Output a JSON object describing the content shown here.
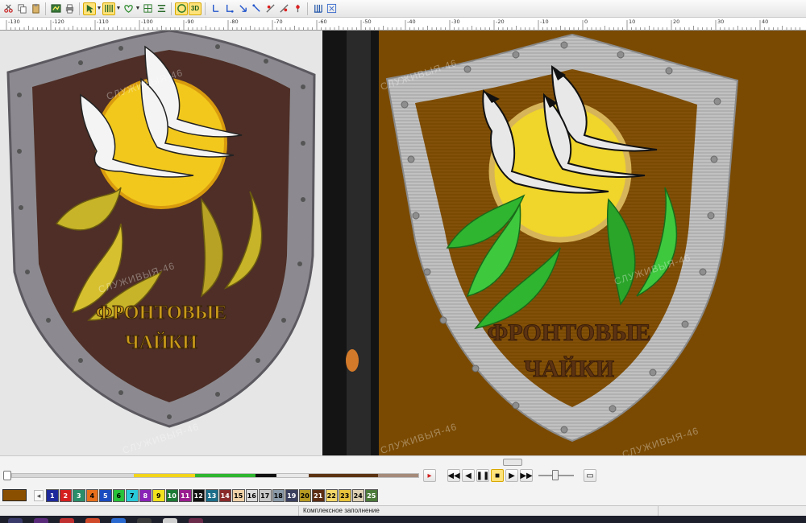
{
  "toolbar": {
    "icons": [
      "cut-icon",
      "copy-icon",
      "paste-icon",
      "stitch-view-icon",
      "print-icon",
      "select-icon",
      "fill-icon",
      "heart-icon",
      "grid-icon",
      "align-icon",
      "realistic-icon",
      "3d-icon",
      "arrow-icon",
      "arrow-icon",
      "arrow-icon",
      "arrow-icon",
      "needle-icon",
      "needle-icon",
      "needle-icon",
      "column-icon",
      "ruler-icon"
    ],
    "view_3d_label": "3D"
  },
  "ruler": {
    "ticks": [
      "-130",
      "-120",
      "-110",
      "-100",
      "-90",
      "-80",
      "-70",
      "-60",
      "-50",
      "-40",
      "-30",
      "-20",
      "-10",
      "0",
      "10",
      "20",
      "30",
      "40"
    ]
  },
  "artwork": {
    "title_line1": "ФРОНТОВЫЕ",
    "title_line2": "ЧАЙКИ",
    "watermark": "СЛУЖИВЫЯ-46",
    "background_color": "#7a4a02",
    "shield_border_color": "#b5b5b5"
  },
  "player": {
    "color_track": [
      {
        "color": "#d7d7d7",
        "share": 30
      },
      {
        "color": "#f2d51a",
        "share": 15
      },
      {
        "color": "#2fb52f",
        "share": 15
      },
      {
        "color": "#111111",
        "share": 5
      },
      {
        "color": "#e8e8e8",
        "share": 8
      },
      {
        "color": "#5c3312",
        "share": 17
      },
      {
        "color": "#a58a7a",
        "share": 10
      }
    ]
  },
  "palette": {
    "current_color": "#8a5000",
    "swatches": [
      {
        "n": "1",
        "c": "#1e2a9b",
        "t": "#ffffff"
      },
      {
        "n": "2",
        "c": "#d51f1f",
        "t": "#ffffff"
      },
      {
        "n": "3",
        "c": "#2a8e6a",
        "t": "#ffffff"
      },
      {
        "n": "4",
        "c": "#e86f1b",
        "t": "#000000"
      },
      {
        "n": "5",
        "c": "#1a4bbf",
        "t": "#ffffff"
      },
      {
        "n": "6",
        "c": "#27c23a",
        "t": "#000000"
      },
      {
        "n": "7",
        "c": "#29c9d9",
        "t": "#000000"
      },
      {
        "n": "8",
        "c": "#8a22b8",
        "t": "#ffffff"
      },
      {
        "n": "9",
        "c": "#f2e11d",
        "t": "#000000"
      },
      {
        "n": "10",
        "c": "#1b7a33",
        "t": "#ffffff"
      },
      {
        "n": "11",
        "c": "#9a1d8f",
        "t": "#ffffff"
      },
      {
        "n": "12",
        "c": "#101010",
        "t": "#ffffff"
      },
      {
        "n": "13",
        "c": "#1b6e8a",
        "t": "#ffffff"
      },
      {
        "n": "14",
        "c": "#8a2a2a",
        "t": "#ffffff"
      },
      {
        "n": "15",
        "c": "#f0d2a8",
        "t": "#000000"
      },
      {
        "n": "16",
        "c": "#dadada",
        "t": "#000000"
      },
      {
        "n": "17",
        "c": "#c8c8c8",
        "t": "#000000"
      },
      {
        "n": "18",
        "c": "#8a9aa8",
        "t": "#000000"
      },
      {
        "n": "19",
        "c": "#3a3f5e",
        "t": "#ffffff"
      },
      {
        "n": "20",
        "c": "#b79a22",
        "t": "#000000"
      },
      {
        "n": "21",
        "c": "#5c2d12",
        "t": "#ffffff"
      },
      {
        "n": "22",
        "c": "#f4d96a",
        "t": "#000000"
      },
      {
        "n": "23",
        "c": "#e8c43c",
        "t": "#000000"
      },
      {
        "n": "24",
        "c": "#dfd2b4",
        "t": "#000000"
      },
      {
        "n": "25",
        "c": "#4c7a3a",
        "t": "#ffffff"
      }
    ]
  },
  "status": {
    "text": "Комплексное заполнение"
  }
}
